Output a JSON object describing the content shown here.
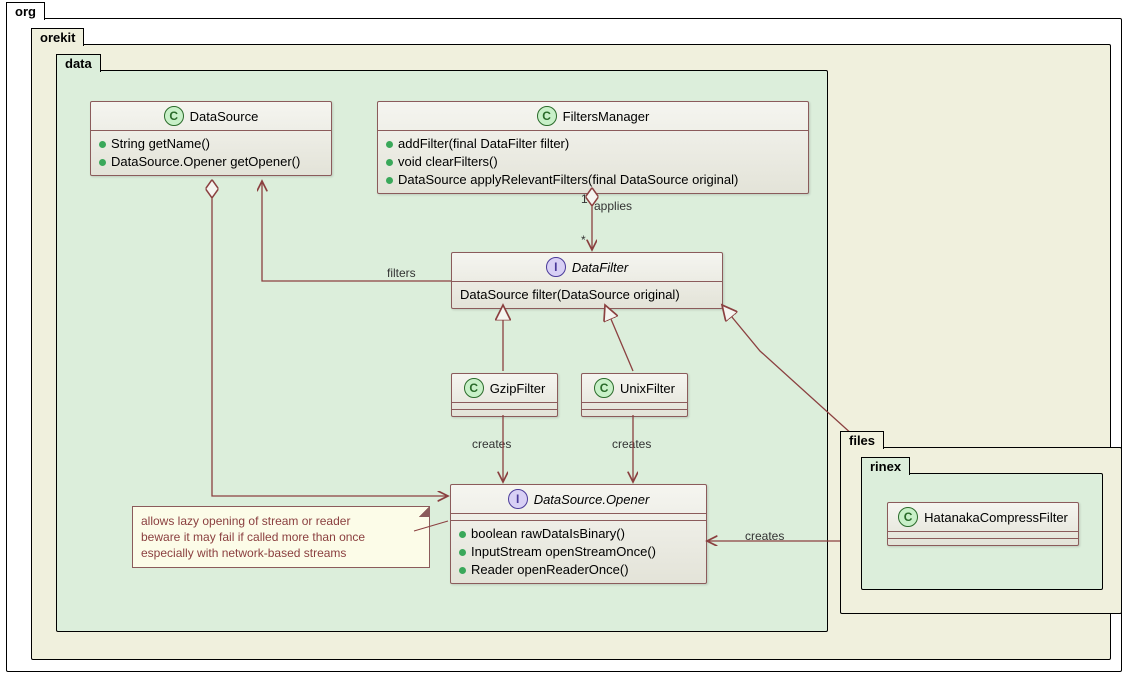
{
  "packages": {
    "org": "org",
    "orekit": "orekit",
    "data": "data",
    "files": "files",
    "rinex": "rinex"
  },
  "classes": {
    "DataSource": {
      "stereotype": "C",
      "name": "DataSource",
      "members": [
        "String getName()",
        "DataSource.Opener getOpener()"
      ]
    },
    "FiltersManager": {
      "stereotype": "C",
      "name": "FiltersManager",
      "members": [
        "addFilter(final DataFilter filter)",
        "void clearFilters()",
        "DataSource applyRelevantFilters(final DataSource original)"
      ]
    },
    "DataFilter": {
      "stereotype": "I",
      "name": "DataFilter",
      "members": [
        "DataSource filter(DataSource original)"
      ]
    },
    "GzipFilter": {
      "stereotype": "C",
      "name": "GzipFilter"
    },
    "UnixFilter": {
      "stereotype": "C",
      "name": "UnixFilter"
    },
    "Opener": {
      "stereotype": "I",
      "name": "DataSource.Opener",
      "members": [
        "boolean rawDataIsBinary()",
        "InputStream openStreamOnce()",
        "Reader       openReaderOnce()"
      ]
    },
    "Hatanaka": {
      "stereotype": "C",
      "name": "HatanakaCompressFilter"
    }
  },
  "labels": {
    "applies": "applies",
    "filters": "filters",
    "creates1": "creates",
    "creates2": "creates",
    "creates3": "creates",
    "mult1": "1",
    "multN": "*"
  },
  "noteLines": [
    "allows lazy opening of stream or reader",
    "beware it may fail if called more than once",
    "especially with network-based streams"
  ]
}
